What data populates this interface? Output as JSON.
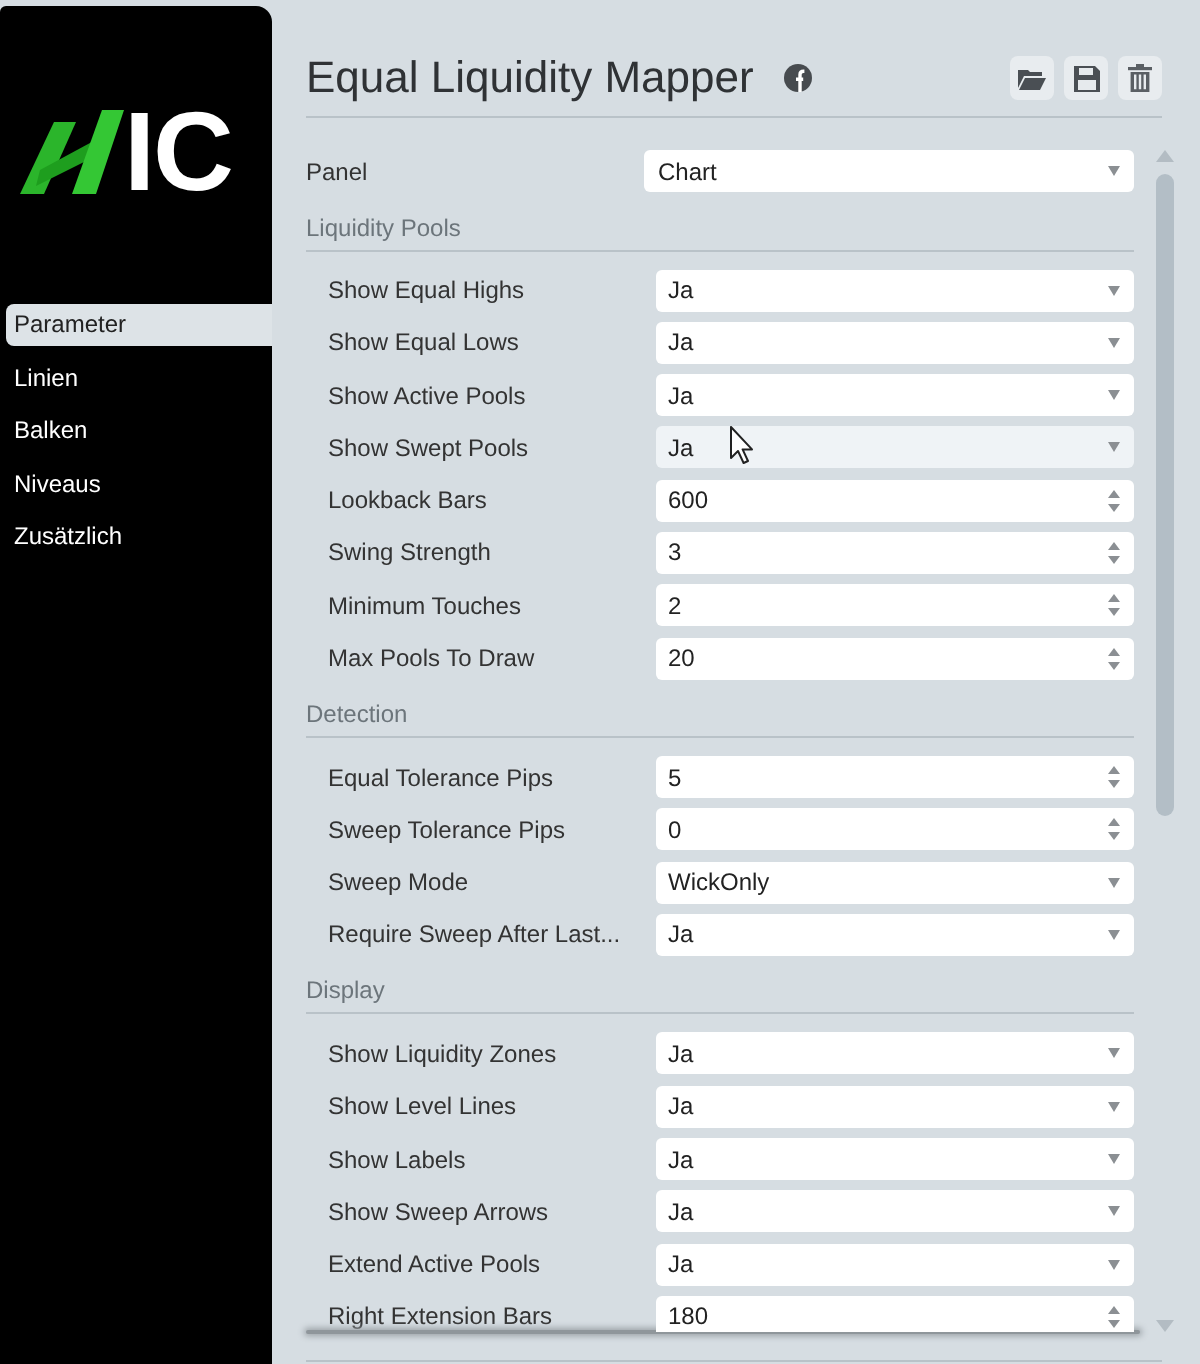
{
  "sidebar": {
    "logo_text": "IC",
    "items": [
      {
        "label": "Parameter",
        "selected": true
      },
      {
        "label": "Linien",
        "selected": false
      },
      {
        "label": "Balken",
        "selected": false
      },
      {
        "label": "Niveaus",
        "selected": false
      },
      {
        "label": "Zusätzlich",
        "selected": false
      }
    ]
  },
  "header": {
    "title": "Equal Liquidity Mapper"
  },
  "panel": {
    "label": "Panel",
    "value": "Chart"
  },
  "sections": [
    {
      "title": "Liquidity Pools",
      "rows": [
        {
          "label": "Show Equal Highs",
          "kind": "select",
          "value": "Ja",
          "hovered": false
        },
        {
          "label": "Show Equal Lows",
          "kind": "select",
          "value": "Ja",
          "hovered": false
        },
        {
          "label": "Show Active Pools",
          "kind": "select",
          "value": "Ja",
          "hovered": false
        },
        {
          "label": "Show Swept Pools",
          "kind": "select",
          "value": "Ja",
          "hovered": true
        },
        {
          "label": "Lookback Bars",
          "kind": "number",
          "value": "600",
          "hovered": false
        },
        {
          "label": "Swing Strength",
          "kind": "number",
          "value": "3",
          "hovered": false
        },
        {
          "label": "Minimum Touches",
          "kind": "number",
          "value": "2",
          "hovered": false
        },
        {
          "label": "Max Pools To Draw",
          "kind": "number",
          "value": "20",
          "hovered": false
        }
      ]
    },
    {
      "title": "Detection",
      "rows": [
        {
          "label": "Equal Tolerance Pips",
          "kind": "number",
          "value": "5",
          "hovered": false
        },
        {
          "label": "Sweep Tolerance Pips",
          "kind": "number",
          "value": "0",
          "hovered": false
        },
        {
          "label": "Sweep Mode",
          "kind": "select",
          "value": "WickOnly",
          "hovered": false
        },
        {
          "label": "Require Sweep After Last...",
          "kind": "select",
          "value": "Ja",
          "hovered": false
        }
      ]
    },
    {
      "title": "Display",
      "rows": [
        {
          "label": "Show Liquidity Zones",
          "kind": "select",
          "value": "Ja",
          "hovered": false
        },
        {
          "label": "Show Level Lines",
          "kind": "select",
          "value": "Ja",
          "hovered": false
        },
        {
          "label": "Show Labels",
          "kind": "select",
          "value": "Ja",
          "hovered": false
        },
        {
          "label": "Show Sweep Arrows",
          "kind": "select",
          "value": "Ja",
          "hovered": false
        },
        {
          "label": "Extend Active Pools",
          "kind": "select",
          "value": "Ja",
          "hovered": false
        },
        {
          "label": "Right Extension Bars",
          "kind": "number",
          "value": "180",
          "hovered": false
        }
      ]
    }
  ]
}
